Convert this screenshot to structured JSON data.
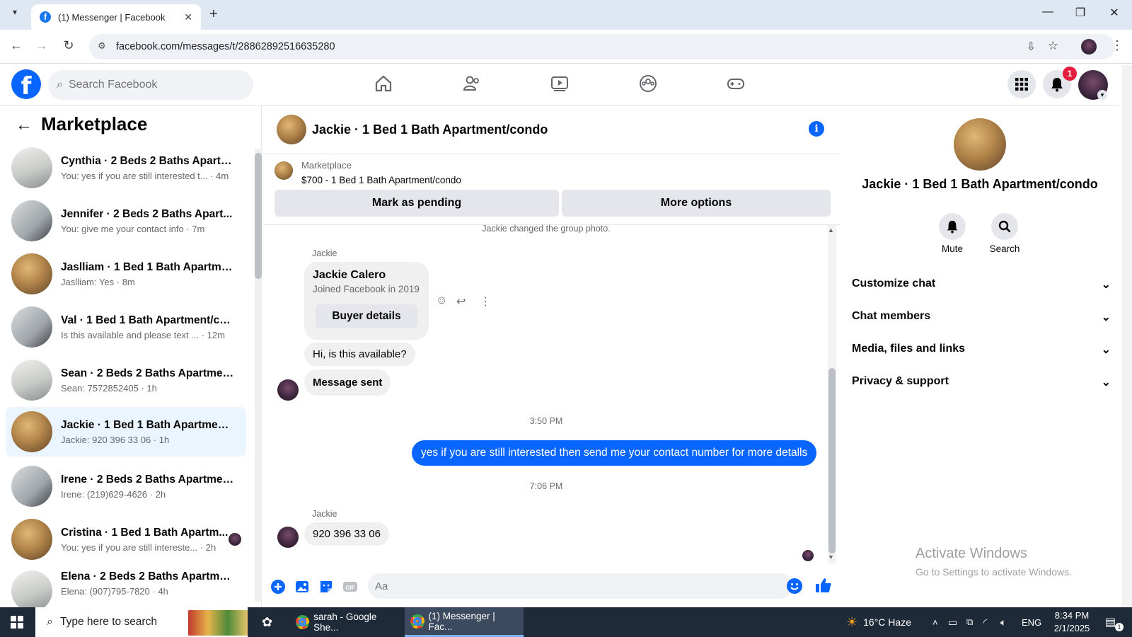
{
  "browser": {
    "tab_title": "(1) Messenger | Facebook",
    "url": "facebook.com/messages/t/28862892516635280",
    "new_tab": "+",
    "win_min": "—",
    "win_max": "❐",
    "win_close": "✕"
  },
  "header": {
    "logo": "f",
    "search_placeholder": "Search Facebook",
    "notifications_count": "1"
  },
  "sidebar": {
    "title": "Marketplace",
    "conversations": [
      {
        "name": "Cynthia · 2 Beds 2 Baths Apartm...",
        "preview": "You: yes if you are still interested t... · 4m"
      },
      {
        "name": "Jennifer · 2 Beds 2 Baths Apart...",
        "preview": "You: give me your contact info · 7m"
      },
      {
        "name": "Jaslliam · 1 Bed 1 Bath Apartmen...",
        "preview": "Jaslliam: Yes · 8m"
      },
      {
        "name": "Val · 1 Bed 1 Bath Apartment/co...",
        "preview": "Is this available and please text ... · 12m"
      },
      {
        "name": "Sean · 2 Beds 2 Baths Apartmen...",
        "preview": "Sean: 7572852405 · 1h"
      },
      {
        "name": "Jackie · 1 Bed 1 Bath Apartment/...",
        "preview": "Jackie: 920 396 33 06 · 1h"
      },
      {
        "name": "Irene · 2 Beds 2 Baths Apartmen...",
        "preview": "Irene: (219)629-4626 · 2h"
      },
      {
        "name": "Cristina · 1 Bed 1 Bath Apartm...",
        "preview": "You: yes if you are still intereste... · 2h"
      },
      {
        "name": "Elena · 2 Beds 2 Baths Apartme...",
        "preview": "Elena: (907)795-7820 · 4h"
      }
    ]
  },
  "chat": {
    "title": "Jackie · 1 Bed 1 Bath Apartment/condo",
    "marketplace_label": "Marketplace",
    "listing": "$700 - 1 Bed 1 Bath Apartment/condo",
    "mark_pending": "Mark as pending",
    "more_options": "More options",
    "system_message": "Jackie changed the group photo.",
    "sender_1": "Jackie",
    "card_name": "Jackie Calero",
    "card_joined": "Joined Facebook in 2019",
    "buyer_details": "Buyer details",
    "msg_available": "Hi, is this available?",
    "msg_sent": "Message sent",
    "time_1": "3:50 PM",
    "outgoing": "yes if you are still interested then send me your contact number for more detalls",
    "time_2": "7:06 PM",
    "sender_2": "Jackie",
    "msg_number": "920 396 33 06",
    "composer_placeholder": "Aa"
  },
  "right_panel": {
    "name": "Jackie · 1 Bed 1 Bath Apartment/condo",
    "mute": "Mute",
    "search": "Search",
    "sections": [
      "Customize chat",
      "Chat members",
      "Media, files and links",
      "Privacy & support"
    ],
    "activate_title": "Activate Windows",
    "activate_sub": "Go to Settings to activate Windows."
  },
  "taskbar": {
    "search_placeholder": "Type here to search",
    "app_sheets": "sarah - Google She...",
    "app_messenger": "(1) Messenger | Fac...",
    "weather": "16°C  Haze",
    "lang": "ENG",
    "time": "8:34 PM",
    "date": "2/1/2025",
    "notif_count": "1"
  }
}
